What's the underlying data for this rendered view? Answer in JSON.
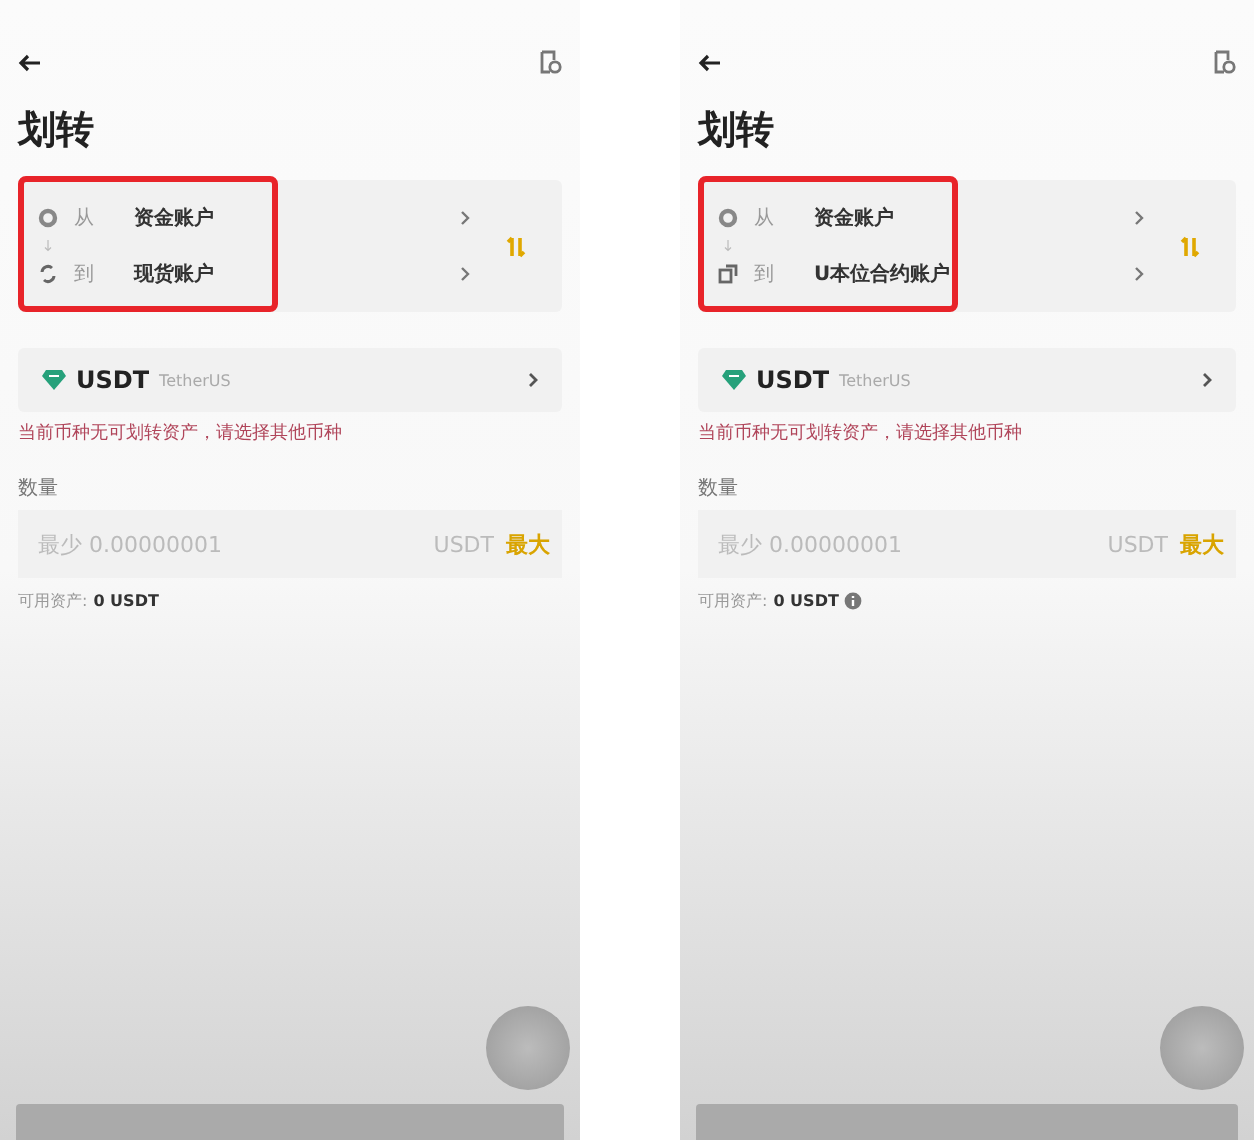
{
  "screens": [
    {
      "title": "划转",
      "accounts": [
        {
          "kind": "funding",
          "label": "从",
          "name": "资金账户"
        },
        {
          "kind": "spot",
          "label": "到",
          "name": "现货账户"
        }
      ],
      "highlighted": true,
      "coin": "USDT",
      "coin_name": "TetherUS",
      "error": "当前币种无可划转资产，请选择其他币种",
      "amount_label": "数量",
      "placeholder": "最少 0.00000001",
      "unit": "USDT",
      "max": "最大",
      "available_label": "可用资产:",
      "available_value": "0 USDT",
      "info_icon": false
    },
    {
      "title": "划转",
      "accounts": [
        {
          "kind": "funding",
          "label": "从",
          "name": "资金账户"
        },
        {
          "kind": "futures",
          "label": "到",
          "name": "U本位合约账户"
        }
      ],
      "highlighted": true,
      "coin": "USDT",
      "coin_name": "TetherUS",
      "error": "当前币种无可划转资产，请选择其他币种",
      "amount_label": "数量",
      "placeholder": "最少 0.00000001",
      "unit": "USDT",
      "max": "最大",
      "available_label": "可用资产:",
      "available_value": "0 USDT",
      "info_icon": true
    }
  ]
}
